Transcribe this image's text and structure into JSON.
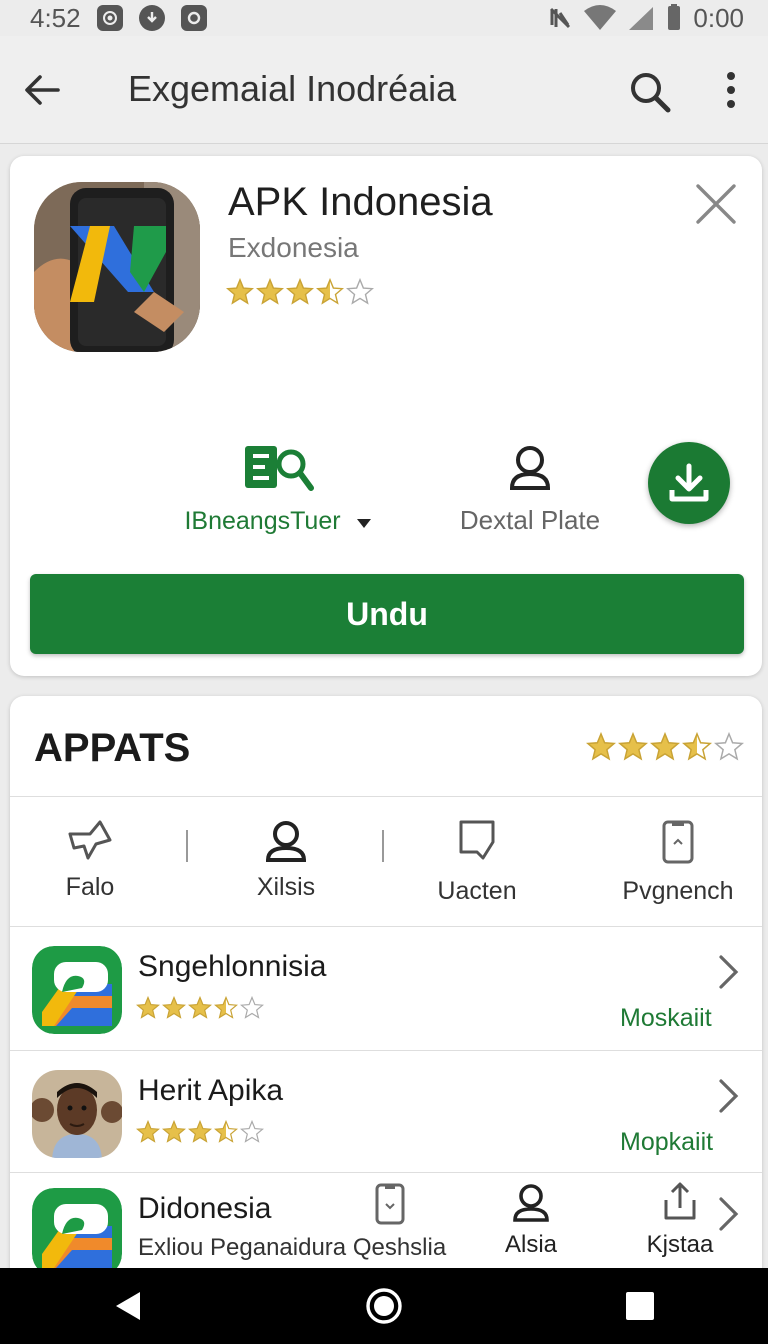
{
  "status_bar": {
    "time_left": "4:52",
    "time_right": "0:00",
    "icons_left": [
      "screen-record-icon",
      "download-icon",
      "camera-icon"
    ],
    "icons_right": [
      "vibrate-off-icon",
      "wifi-icon",
      "signal-icon",
      "battery-icon"
    ]
  },
  "app_bar": {
    "title": "Exgemaial Inodréaia",
    "back_icon": "arrow-left-icon",
    "search_icon": "search-icon",
    "more_icon": "more-vert-icon"
  },
  "hero": {
    "title": "APK Indonesia",
    "subtitle": "Exdonesia",
    "rating": 3.5,
    "rating_max": 5,
    "action_primary_label": "IBneangsTuer",
    "action_secondary_label": "Dextal Plate",
    "install_button_label": "Undu"
  },
  "section": {
    "title": "APPATS",
    "rating": 3.5,
    "rating_max": 5,
    "categories": [
      {
        "label": "Falo",
        "icon": "pin-icon"
      },
      {
        "label": "Xilsis",
        "icon": "person-icon"
      },
      {
        "label": "Uacten",
        "icon": "tag-icon"
      },
      {
        "label": "Pvgnench",
        "icon": "phone-icon"
      }
    ],
    "rows": [
      {
        "title": "Sngehlonnisia",
        "rating": 3.5,
        "status": "Moskaiit"
      },
      {
        "title": "Herit Apika",
        "rating": 3.5,
        "status": "Mopkaiit"
      },
      {
        "title": "Didonesia",
        "subtitle": "Exliou Peganaidura Qeshslia",
        "action_a": "Alsia",
        "action_b": "Kjstaa"
      }
    ]
  },
  "colors": {
    "accent_green": "#1b7f36",
    "star_gold": "#e6c04a",
    "background": "#ececec"
  }
}
